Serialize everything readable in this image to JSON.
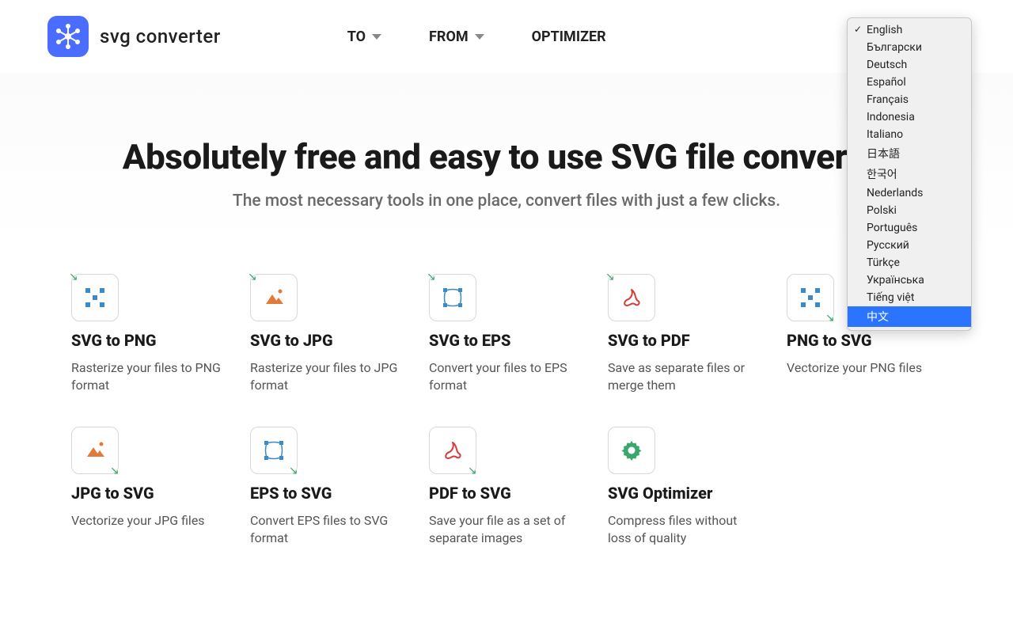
{
  "logo": {
    "text": "svg converter"
  },
  "nav": {
    "to": "TO",
    "from": "FROM",
    "optimizer": "OPTIMIZER"
  },
  "hero": {
    "title": "Absolutely free and easy to use SVG file converter",
    "subtitle": "The most necessary tools in one place, convert files with just a few clicks."
  },
  "cards": [
    {
      "title": "SVG to PNG",
      "desc": "Rasterize your files to PNG format",
      "icon": "pixels",
      "arrow": "tl"
    },
    {
      "title": "SVG to JPG",
      "desc": "Rasterize your files to JPG format",
      "icon": "image",
      "arrow": "tl"
    },
    {
      "title": "SVG to EPS",
      "desc": "Convert your files to EPS format",
      "icon": "vector",
      "arrow": "tl"
    },
    {
      "title": "SVG to PDF",
      "desc": "Save as separate files or merge them",
      "icon": "pdf",
      "arrow": "tl"
    },
    {
      "title": "PNG to SVG",
      "desc": "Vectorize your PNG files",
      "icon": "pixels",
      "arrow": "br"
    },
    {
      "title": "JPG to SVG",
      "desc": "Vectorize your JPG files",
      "icon": "image",
      "arrow": "br"
    },
    {
      "title": "EPS to SVG",
      "desc": "Convert EPS files to SVG format",
      "icon": "vector",
      "arrow": "br"
    },
    {
      "title": "PDF to SVG",
      "desc": "Save your file as a set of separate images",
      "icon": "pdf",
      "arrow": "br"
    },
    {
      "title": "SVG Optimizer",
      "desc": "Compress files without loss of quality",
      "icon": "gear",
      "arrow": "none"
    }
  ],
  "languages": {
    "selected": "English",
    "highlighted": "中文",
    "items": [
      "English",
      "Български",
      "Deutsch",
      "Español",
      "Français",
      "Indonesia",
      "Italiano",
      "日本語",
      "한국어",
      "Nederlands",
      "Polski",
      "Português",
      "Русский",
      "Türkçe",
      "Українська",
      "Tiếng việt",
      "中文"
    ]
  }
}
